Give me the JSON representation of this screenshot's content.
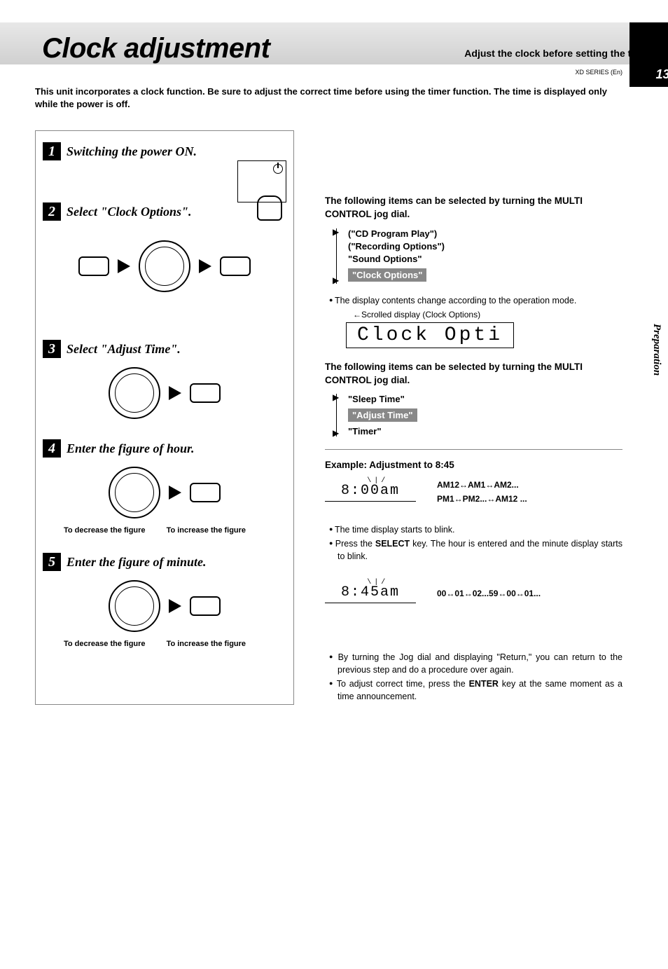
{
  "header": {
    "title": "Clock adjustment",
    "subtitle": "Adjust the clock before setting the timer.",
    "page_number": "13",
    "series": "XD SERIES (En)"
  },
  "intro": "This unit incorporates a clock function. Be sure to adjust the correct time before using the timer function. The time is displayed only while the power is off.",
  "side_tab": "Preparation",
  "steps": {
    "s1": {
      "num": "1",
      "title": "Switching the power ON."
    },
    "s2": {
      "num": "2",
      "title": "Select \"Clock Options\"."
    },
    "s3": {
      "num": "3",
      "title": "Select \"Adjust Time\"."
    },
    "s4": {
      "num": "4",
      "title": "Enter the figure of hour.",
      "cap_left": "To decrease the figure",
      "cap_right": "To increase the figure"
    },
    "s5": {
      "num": "5",
      "title": "Enter the figure of minute.",
      "cap_left": "To decrease the figure",
      "cap_right": "To increase the figure"
    }
  },
  "right": {
    "section1": {
      "heading": "The following items can be selected by turning the MULTI CONTROL jog dial.",
      "items": [
        "(\"CD Program Play\")",
        "(\"Recording Options\")",
        "\"Sound Options\"",
        "\"Clock Options\""
      ],
      "selected_index": 3,
      "bullet1": "The display contents change according to the operation mode.",
      "scroll_label": "←Scrolled display (Clock Options)",
      "lcd": "Clock Opti"
    },
    "section2": {
      "heading": "The following items can be selected by turning the MULTI CONTROL jog dial.",
      "items": [
        "\"Sleep Time\"",
        "\"Adjust Time\"",
        "\"Timer\""
      ],
      "selected_index": 1
    },
    "example": {
      "heading": "Example: Adjustment to 8:45",
      "hour_display": "8:00am",
      "hour_seq_line1": "AM12↔AM1↔AM2...",
      "hour_seq_line2": "PM1↔PM2...↔AM12 ...",
      "bullet_a": "The time display starts to blink.",
      "bullet_b_pre": "Press the ",
      "bullet_b_bold": "SELECT",
      "bullet_b_post": " key. The hour is entered and the minute display starts to blink.",
      "minute_display": "8:45am",
      "minute_seq": "00↔01↔02...59↔00↔01...",
      "bullet_c": "By turning the Jog dial and displaying \"Return,\" you can return to the previous step and do a procedure over again.",
      "bullet_d_pre": "To adjust correct time, press the ",
      "bullet_d_bold": "ENTER",
      "bullet_d_post": " key at the same moment as a time announcement."
    }
  }
}
